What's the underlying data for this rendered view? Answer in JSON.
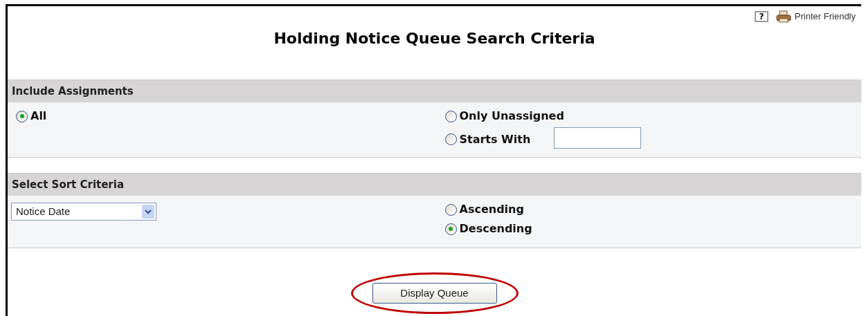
{
  "toolbar": {
    "help": "?",
    "printer_link": "Printer Friendly"
  },
  "title": "Holding Notice Queue Search Criteria",
  "assignments": {
    "heading": "Include Assignments",
    "options": [
      {
        "label": "All",
        "selected": true,
        "kind": "plain"
      },
      {
        "label": "Only Unassigned",
        "selected": false,
        "kind": "plain"
      },
      {
        "label": "Starts With",
        "selected": false,
        "kind": "with-field"
      }
    ]
  },
  "sort": {
    "heading": "Select Sort Criteria",
    "dropdown": "Notice Date",
    "options": [
      {
        "label": "Ascending",
        "selected": false
      },
      {
        "label": "Descending",
        "selected": true
      }
    ]
  },
  "button": {
    "label": "Display Queue",
    "highlighted": true
  }
}
